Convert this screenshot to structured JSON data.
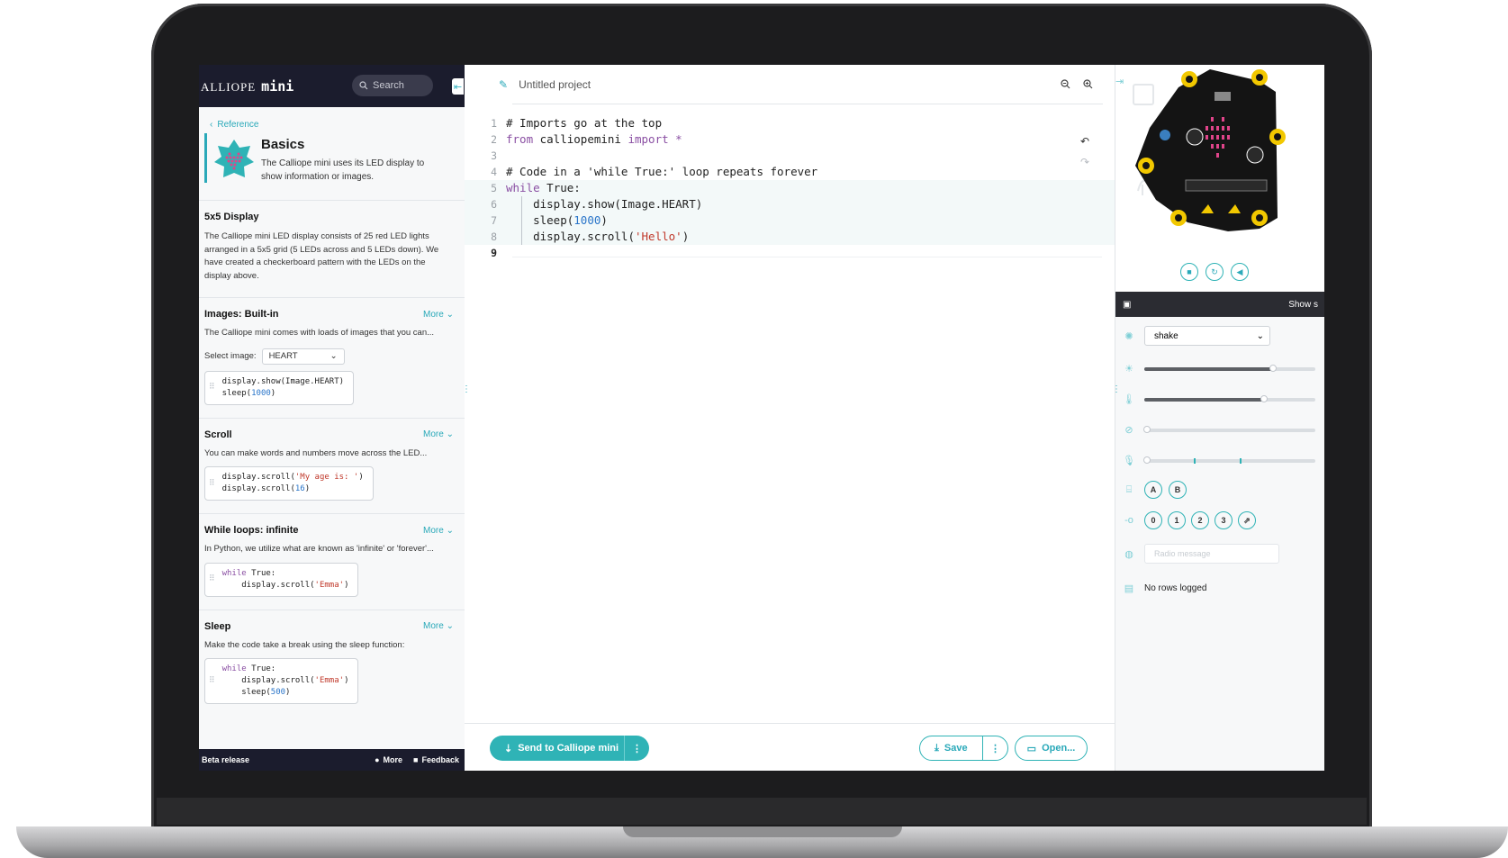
{
  "left": {
    "brand": "ALLIOPE",
    "brand_mini": "mini",
    "search_placeholder": "Search",
    "back_link": "Reference",
    "basics_title": "Basics",
    "basics_desc": "The Calliope mini uses its LED display to show information or images.",
    "sections": [
      {
        "title": "5x5 Display",
        "more": "",
        "desc": "The Calliope mini LED display consists of 25 red LED lights arranged in a 5x5 grid (5 LEDs across and 5 LEDs down). We have created a checkerboard pattern with the LEDs on the display above."
      },
      {
        "title": "Images: Built-in",
        "more": "More",
        "desc": "The Calliope mini comes with loads of images that you can...",
        "select_label": "Select image:",
        "select_value": "HEART"
      },
      {
        "title": "Scroll",
        "more": "More",
        "desc": "You can make words and numbers move across the LED..."
      },
      {
        "title": "While loops: infinite",
        "more": "More",
        "desc": "In Python, we utilize what are known as 'infinite' or 'forever'..."
      },
      {
        "title": "Sleep",
        "more": "More",
        "desc": "Make the code take a break using the sleep function:"
      }
    ],
    "footer": {
      "beta": "Beta release",
      "more": "More",
      "feedback": "Feedback"
    }
  },
  "editor": {
    "project_name": "Untitled project",
    "line_numbers": [
      "1",
      "2",
      "3",
      "4",
      "5",
      "6",
      "7",
      "8",
      "9"
    ],
    "send_button": "Send to Calliope mini",
    "save_button": "Save",
    "open_button": "Open..."
  },
  "simulator": {
    "bar_label": "Show s",
    "gesture_value": "shake",
    "button_labels": [
      "A",
      "B"
    ],
    "pin_labels": [
      "0",
      "1",
      "2",
      "3"
    ],
    "radio_placeholder": "Radio message",
    "log_status": "No rows logged",
    "light_level": 0.75,
    "temperature_level": 0.7
  },
  "colors": {
    "accent": "#2fb3b6",
    "header_dark": "#1b1c2d",
    "comment": "#1f8fb3",
    "keyword": "#8a4fa3",
    "string": "#c0392b",
    "number": "#2a75c9"
  }
}
